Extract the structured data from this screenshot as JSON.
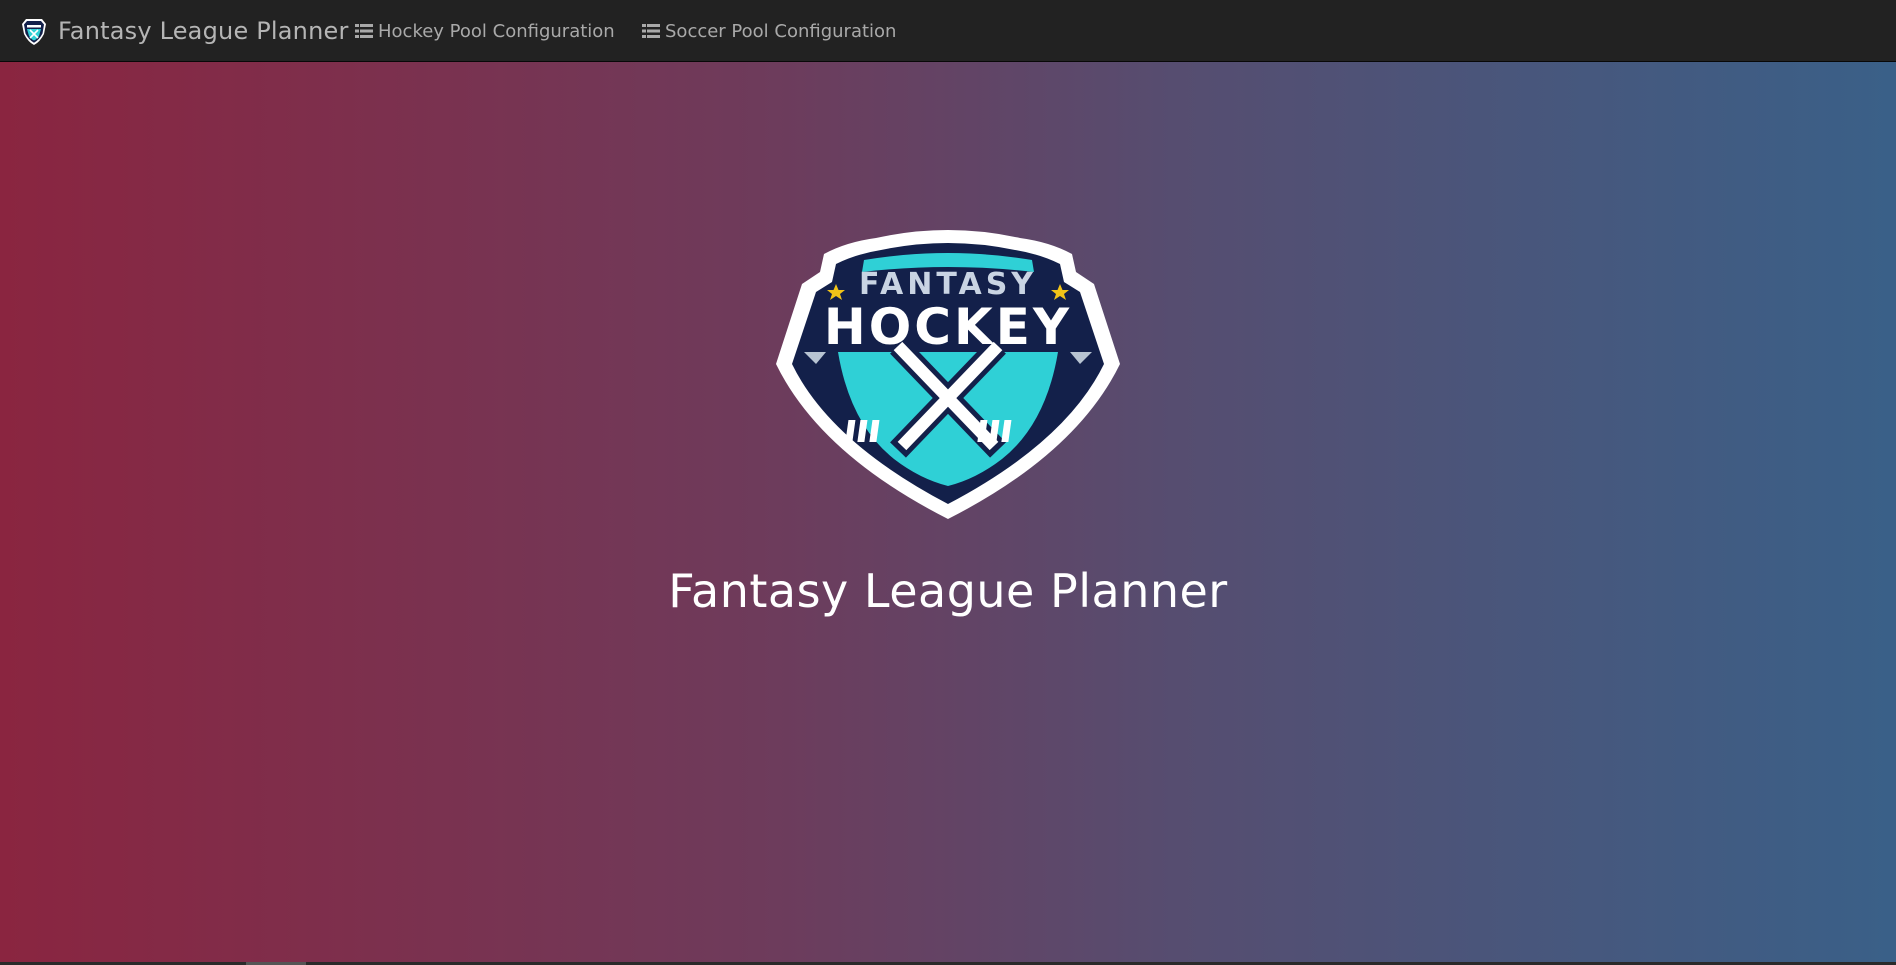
{
  "navbar": {
    "brand_text": "Fantasy League Planner",
    "brand_icon": "fantasy-hockey-shield-icon",
    "links": [
      {
        "label": "Hockey Pool Configuration",
        "icon": "list-icon"
      },
      {
        "label": "Soccer Pool Configuration",
        "icon": "list-icon"
      }
    ]
  },
  "hero": {
    "logo_top_text": "FANTASY",
    "logo_main_text": "HOCKEY",
    "title": "Fantasy League Planner"
  },
  "colors": {
    "navbar_bg": "#222222",
    "nav_text": "#a9a9a9",
    "gradient_left": "#8a2540",
    "gradient_right": "#3a6088",
    "logo_navy": "#13204a",
    "logo_teal": "#2fd0d6",
    "logo_star": "#f2c418"
  }
}
